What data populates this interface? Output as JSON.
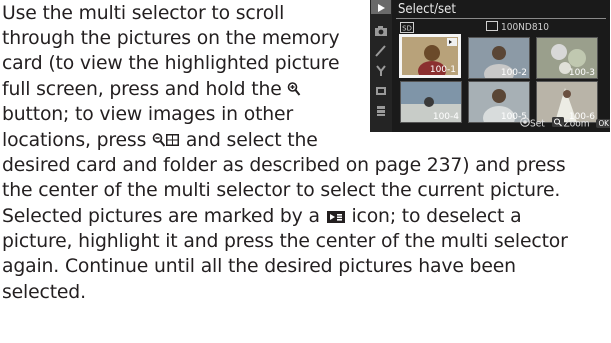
{
  "document": {
    "lines": [
      {
        "text": "Use the multi selector to scroll"
      },
      {
        "text": "through the pictures on the memory"
      },
      {
        "text": "card (to view the highlighted picture"
      },
      {
        "pre": "full screen, press and hold the ",
        "post": ""
      },
      {
        "text": "button; to view images in other"
      },
      {
        "pre": "locations, press ",
        "post": " and select the"
      },
      {
        "text": "desired card and folder as described on page 237) and press"
      },
      {
        "text": "the center of the multi selector to select the current picture."
      },
      {
        "pre": "Selected pictures are marked by a ",
        "post": " icon; to deselect a"
      },
      {
        "text": "picture, highlight it and press the center of the multi selector"
      },
      {
        "text": "again.  Continue until all the desired pictures have been"
      },
      {
        "text": "selected."
      }
    ]
  },
  "camera_screen": {
    "title": "Select/set",
    "card_tag": "SD",
    "folder": "100ND810",
    "thumbnails": [
      {
        "label": "100-1",
        "selected": true,
        "marked": true,
        "tone": "#b8a27a"
      },
      {
        "label": "100-2",
        "selected": false,
        "marked": false,
        "tone": "#8c9aa6"
      },
      {
        "label": "100-3",
        "selected": false,
        "marked": false,
        "tone": "#9a9f8c"
      },
      {
        "label": "100-4",
        "selected": false,
        "marked": false,
        "tone": "#7f95a8"
      },
      {
        "label": "100-5",
        "selected": false,
        "marked": false,
        "tone": "#a7b0b5"
      },
      {
        "label": "100-6",
        "selected": false,
        "marked": false,
        "tone": "#b9b4a8"
      }
    ],
    "footer": {
      "set_label": "Set",
      "zoom_label": "Zoom",
      "ok_chip": "OK",
      "ok_label": "OK"
    },
    "colors": {
      "background": "#1a1a1a",
      "text": "#e8e8e8",
      "highlight": "#f5f5f5"
    }
  }
}
